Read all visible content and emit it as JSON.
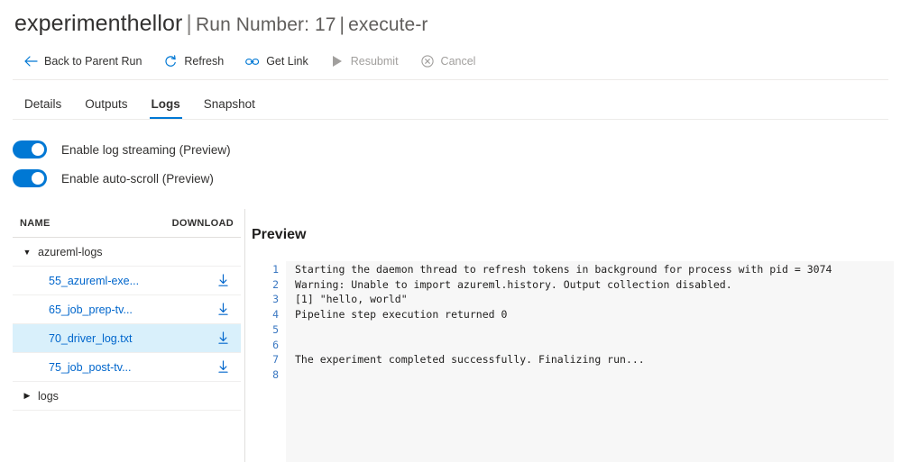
{
  "header": {
    "experiment_name": "experimenthellor",
    "separator": "|",
    "run_number_label": "Run Number: 17",
    "step_name": "execute-r"
  },
  "command_bar": {
    "items": [
      {
        "label": "Back to Parent Run",
        "icon": "arrow-left-icon",
        "disabled": false
      },
      {
        "label": "Refresh",
        "icon": "refresh-icon",
        "disabled": false
      },
      {
        "label": "Get Link",
        "icon": "link-icon",
        "disabled": false
      },
      {
        "label": "Resubmit",
        "icon": "play-icon",
        "disabled": true
      },
      {
        "label": "Cancel",
        "icon": "cancel-circle-icon",
        "disabled": true
      }
    ]
  },
  "tabs": [
    {
      "label": "Details",
      "active": false
    },
    {
      "label": "Outputs",
      "active": false
    },
    {
      "label": "Logs",
      "active": true
    },
    {
      "label": "Snapshot",
      "active": false
    }
  ],
  "toggles": [
    {
      "label": "Enable log streaming (Preview)",
      "on": true
    },
    {
      "label": "Enable auto-scroll (Preview)",
      "on": true
    }
  ],
  "file_list": {
    "columns": {
      "name": "NAME",
      "download": "DOWNLOAD"
    },
    "rows": [
      {
        "type": "group",
        "label": "azureml-logs",
        "expanded": true,
        "caret": "▼"
      },
      {
        "type": "file",
        "label": "55_azureml-exe...",
        "selected": false,
        "download_icon": "download-icon"
      },
      {
        "type": "file",
        "label": "65_job_prep-tv...",
        "selected": false,
        "download_icon": "download-icon"
      },
      {
        "type": "file",
        "label": "70_driver_log.txt",
        "selected": true,
        "download_icon": "download-icon"
      },
      {
        "type": "file",
        "label": "75_job_post-tv...",
        "selected": false,
        "download_icon": "download-icon"
      },
      {
        "type": "group",
        "label": "logs",
        "expanded": false,
        "caret": "▶"
      }
    ]
  },
  "preview": {
    "title": "Preview",
    "lines": [
      {
        "number": "1",
        "text": "Starting the daemon thread to refresh tokens in background for process with pid = 3074"
      },
      {
        "number": "2",
        "text": "Warning: Unable to import azureml.history. Output collection disabled."
      },
      {
        "number": "3",
        "text": "[1] \"hello, world\""
      },
      {
        "number": "4",
        "text": "Pipeline step execution returned 0"
      },
      {
        "number": "5",
        "text": ""
      },
      {
        "number": "6",
        "text": ""
      },
      {
        "number": "7",
        "text": "The experiment completed successfully. Finalizing run..."
      },
      {
        "number": "8",
        "text": ""
      }
    ]
  },
  "colors": {
    "accent": "#0078d4",
    "link": "#0066cc",
    "selected_row": "#d9f0fb",
    "disabled_text": "#a19f9d",
    "line_number": "#3b78c2",
    "code_bg": "#f7f7f7"
  }
}
